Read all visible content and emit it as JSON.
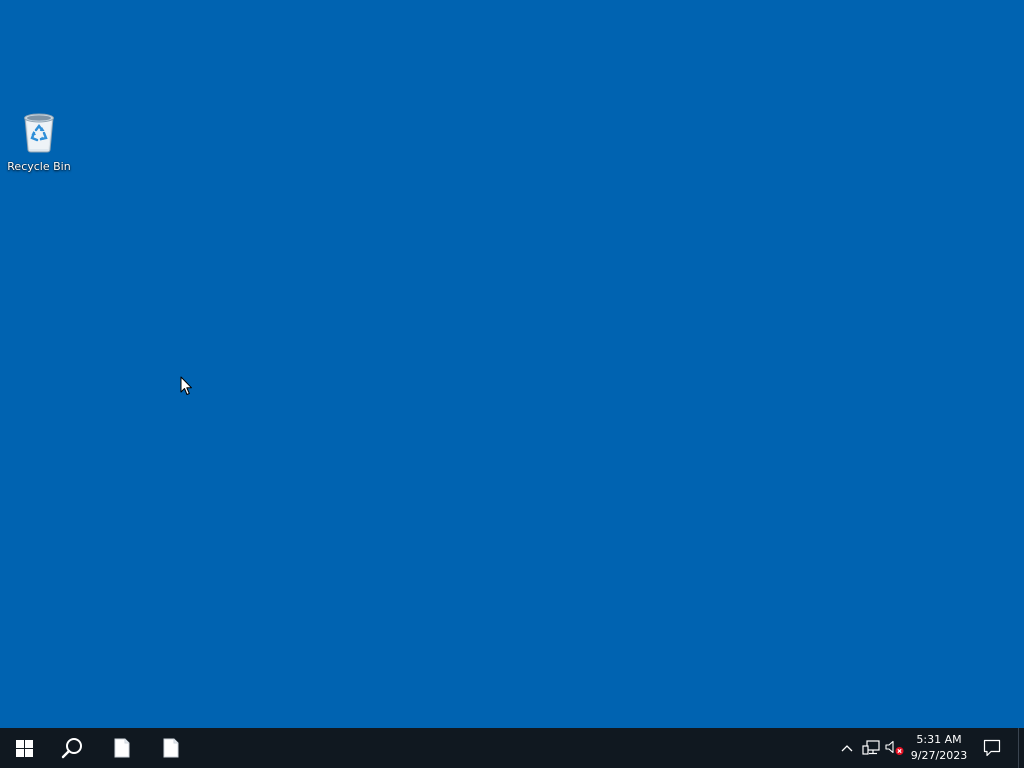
{
  "desktop": {
    "background_color": "#0063b1",
    "icons": [
      {
        "label": "Recycle Bin",
        "icon": "recycle-bin-icon"
      }
    ]
  },
  "taskbar": {
    "background_color": "#101820",
    "start_icon": "windows-logo-icon",
    "search_icon": "search-icon",
    "apps": [
      {
        "icon": "document-icon"
      },
      {
        "icon": "document-icon"
      }
    ],
    "tray": {
      "chevron_icon": "chevron-up-icon",
      "network_icon": "network-icon",
      "volume_icon": "volume-muted-icon",
      "notification_icon": "notification-icon"
    },
    "clock": {
      "time": "5:31 AM",
      "date": "9/27/2023"
    }
  }
}
